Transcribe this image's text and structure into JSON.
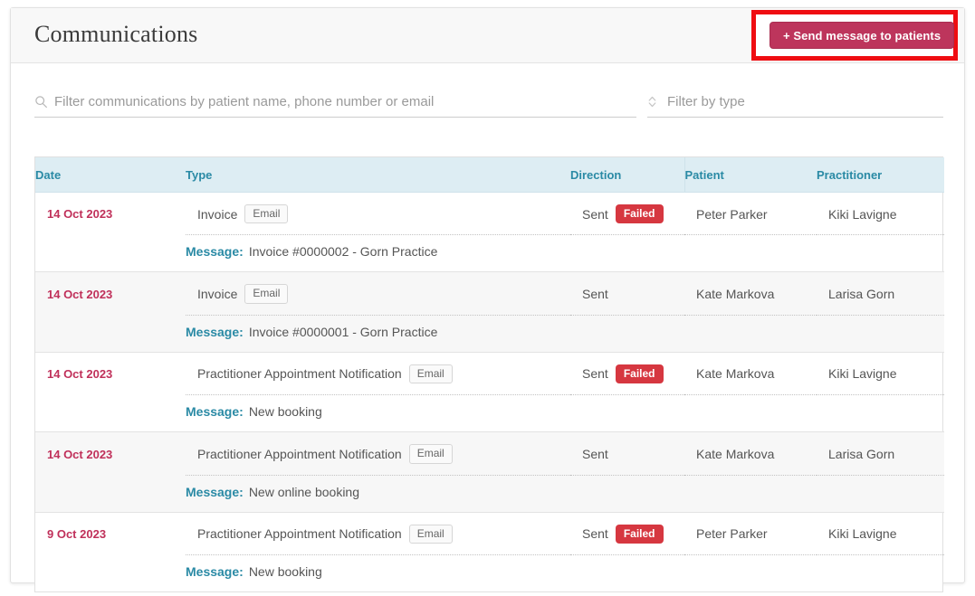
{
  "header": {
    "title": "Communications",
    "send_button_label": "+ Send message to patients"
  },
  "filters": {
    "search_placeholder": "Filter communications by patient name, phone number or email",
    "search_icon": "search-icon",
    "type_placeholder": "Filter by type",
    "type_icon": "sort-chevrons-icon"
  },
  "table": {
    "columns": [
      "Date",
      "Type",
      "Direction",
      "Patient",
      "Practitioner"
    ],
    "message_label": "Message:",
    "rows": [
      {
        "date": "14 Oct 2023",
        "type": "Invoice",
        "channel": "Email",
        "direction": "Sent",
        "status": "Failed",
        "patient": "Peter Parker",
        "practitioner": "Kiki Lavigne",
        "message": "Invoice #0000002 - Gorn Practice"
      },
      {
        "date": "14 Oct 2023",
        "type": "Invoice",
        "channel": "Email",
        "direction": "Sent",
        "status": "",
        "patient": "Kate Markova",
        "practitioner": "Larisa Gorn",
        "message": "Invoice #0000001 - Gorn Practice"
      },
      {
        "date": "14 Oct 2023",
        "type": "Practitioner Appointment Notification",
        "channel": "Email",
        "direction": "Sent",
        "status": "Failed",
        "patient": "Kate Markova",
        "practitioner": "Kiki Lavigne",
        "message": "New booking"
      },
      {
        "date": "14 Oct 2023",
        "type": "Practitioner Appointment Notification",
        "channel": "Email",
        "direction": "Sent",
        "status": "",
        "patient": "Kate Markova",
        "practitioner": "Larisa Gorn",
        "message": "New online booking"
      },
      {
        "date": "9 Oct 2023",
        "type": "Practitioner Appointment Notification",
        "channel": "Email",
        "direction": "Sent",
        "status": "Failed",
        "patient": "Peter Parker",
        "practitioner": "Kiki Lavigne",
        "message": "New booking"
      }
    ]
  },
  "colors": {
    "accent_teal": "#2a8aa5",
    "header_band": "#ddedf3",
    "date_crimson": "#c0305a",
    "button_pink": "#bd355c",
    "failed_red": "#d63740",
    "annotation_red": "#ef0d12"
  }
}
